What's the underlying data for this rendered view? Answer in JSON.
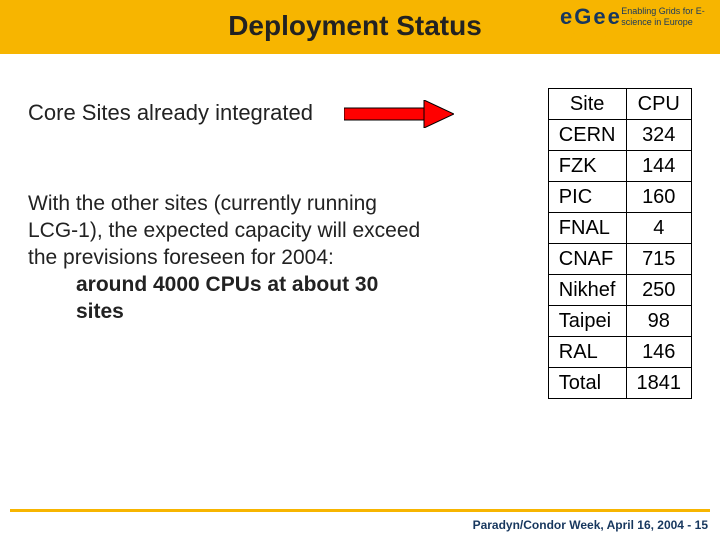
{
  "title": "Deployment Status",
  "logo": {
    "letters": "eGee",
    "tagline": "Enabling Grids for E-science in Europe"
  },
  "subheading": "Core Sites already integrated",
  "body": {
    "para": "With the other sites (currently running LCG-1), the expected capacity will exceed the previsions foreseen for 2004:",
    "strong": "around 4000 CPUs at about 30 sites"
  },
  "table": {
    "headers": [
      "Site",
      "CPU"
    ],
    "rows": [
      {
        "site": "CERN",
        "cpu": "324"
      },
      {
        "site": "FZK",
        "cpu": "144"
      },
      {
        "site": "PIC",
        "cpu": "160"
      },
      {
        "site": "FNAL",
        "cpu": "4"
      },
      {
        "site": "CNAF",
        "cpu": "715"
      },
      {
        "site": "Nikhef",
        "cpu": "250"
      },
      {
        "site": "Taipei",
        "cpu": "98"
      },
      {
        "site": "RAL",
        "cpu": "146"
      },
      {
        "site": "Total",
        "cpu": "1841"
      }
    ]
  },
  "footer": "Paradyn/Condor Week, April 16, 2004 -  15"
}
